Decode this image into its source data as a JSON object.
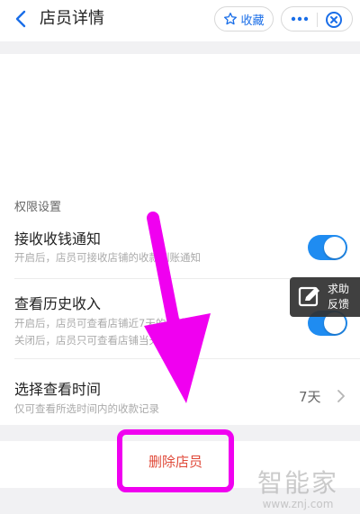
{
  "header": {
    "title": "店员详情",
    "favorite_label": "收藏"
  },
  "permissions": {
    "section_label": "权限设置",
    "rows": [
      {
        "title": "接收收钱通知",
        "desc": [
          "开启后，店员可接收店铺的收款到账通知"
        ],
        "enabled": true
      },
      {
        "title": "查看历史收入",
        "desc": [
          "开启后，店员可查看店铺近7天的收款记录",
          "关闭后，店员只可查看店铺当天的收入"
        ],
        "enabled": true
      },
      {
        "title": "选择查看时间",
        "desc": [
          "仅可查看所选时间内的收款记录"
        ],
        "value": "7天"
      }
    ]
  },
  "help_widget": {
    "lines": [
      "求助",
      "反馈"
    ]
  },
  "delete_button": {
    "label": "删除店员"
  },
  "watermark": {
    "text": "智能家",
    "url": "www.znj.com"
  },
  "colors": {
    "accent": "#1f8cf1",
    "delete": "#e04a3a",
    "annotation": "#f000f0"
  }
}
